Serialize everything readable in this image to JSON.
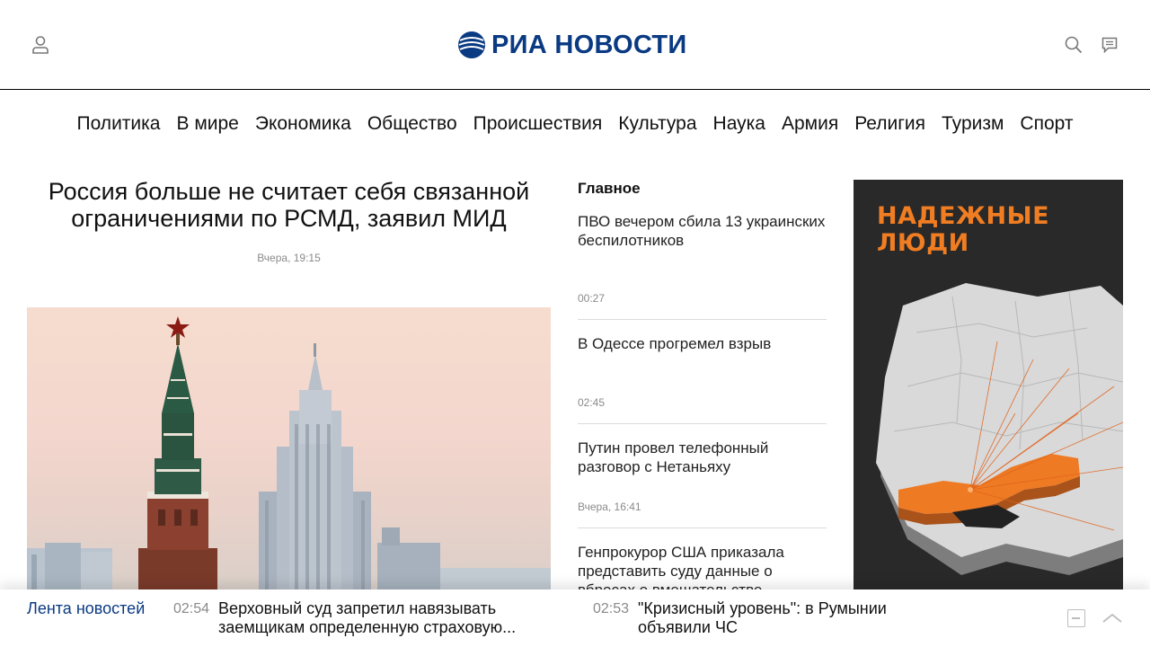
{
  "header": {
    "logo_text": "РИА НОВОСТИ",
    "icons": [
      "user-icon",
      "search-icon",
      "chat-icon"
    ]
  },
  "nav": {
    "items": [
      "Политика",
      "В мире",
      "Экономика",
      "Общество",
      "Происшествия",
      "Культура",
      "Наука",
      "Армия",
      "Религия",
      "Туризм",
      "Спорт"
    ]
  },
  "main_article": {
    "title": "Россия больше не считает себя связанной ограничениями по РСМД, заявил МИД",
    "date": "Вчера, 19:15"
  },
  "headlines": {
    "title": "Главное",
    "items": [
      {
        "text": "ПВО вечером сбила 13 украинских беспилотников",
        "time": "00:27"
      },
      {
        "text": "В Одессе прогремел взрыв",
        "time": "02:45"
      },
      {
        "text": "Путин провел телефонный разговор с Нетаньяху",
        "time": "Вчера, 16:41"
      },
      {
        "text": "Генпрокурор США приказала представить суду данные о вбросах о вмешательстве...",
        "time": ""
      }
    ]
  },
  "ad": {
    "title_line1": "НАДЕЖНЫЕ",
    "title_line2": "ЛЮДИ"
  },
  "newsbar": {
    "label": "Лента новостей",
    "items": [
      {
        "time": "02:54",
        "text": "Верховный суд запретил навязывать заемщикам определенную страховую..."
      },
      {
        "time": "02:53",
        "text": "\"Кризисный уровень\": в Румынии объявили ЧС"
      }
    ]
  },
  "colors": {
    "brand": "#0a3a82",
    "accent": "#f07d22",
    "muted": "#8a8a8a"
  }
}
